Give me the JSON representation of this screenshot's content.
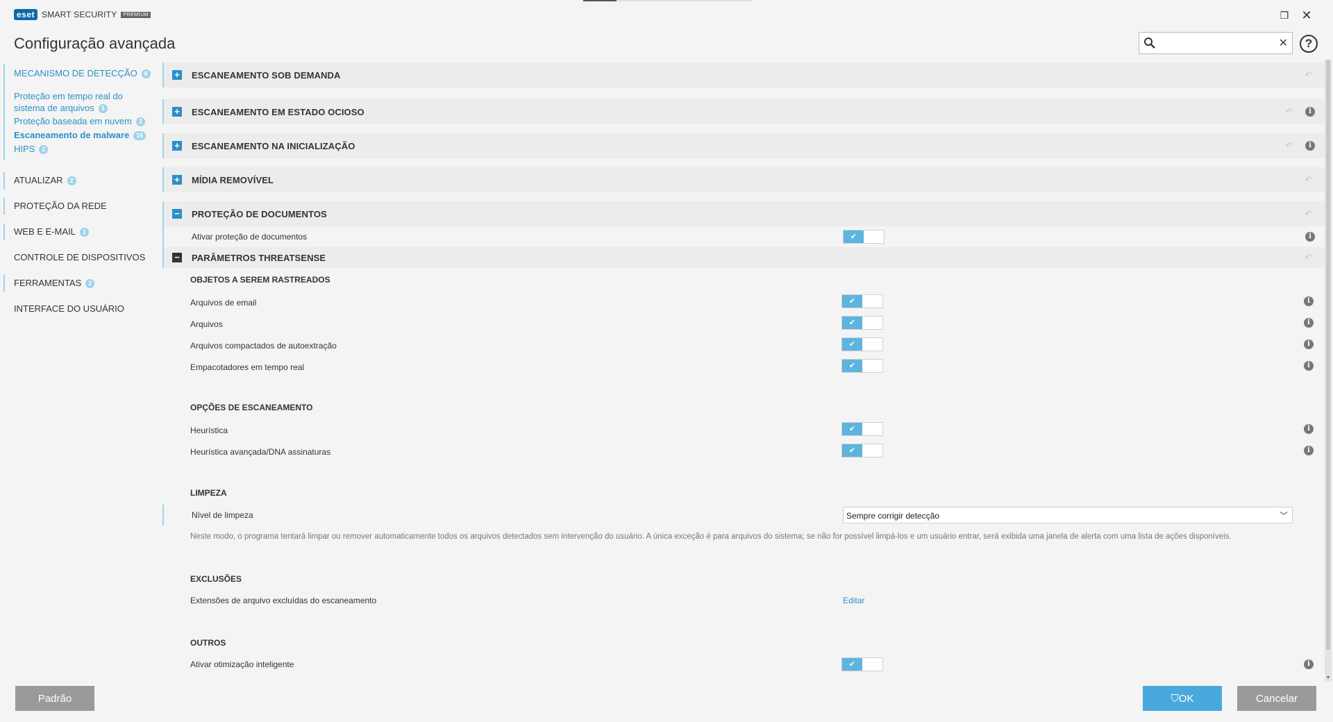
{
  "app": {
    "logo": "eset",
    "product": "SMART SECURITY",
    "edition": "PREMIUM",
    "title": "Configuração avançada"
  },
  "search": {
    "placeholder": "",
    "value": ""
  },
  "sidebar": {
    "detection": {
      "label": "MECANISMO DE DETECÇÃO",
      "badge": "6",
      "items": [
        {
          "label": "Proteção em tempo real do sistema de arquivos",
          "badge": "3"
        },
        {
          "label": "Proteção baseada em nuvem",
          "badge": "3"
        },
        {
          "label": "Escaneamento de malware",
          "badge": "16"
        },
        {
          "label": "HIPS",
          "badge": "2"
        }
      ]
    },
    "items": [
      {
        "label": "ATUALIZAR",
        "badge": "2"
      },
      {
        "label": "PROTEÇÃO DA REDE",
        "badge": ""
      },
      {
        "label": "WEB E E-MAIL",
        "badge": "1"
      },
      {
        "label": "CONTROLE DE DISPOSITIVOS",
        "badge": ""
      },
      {
        "label": "FERRAMENTAS",
        "badge": "2"
      },
      {
        "label": "INTERFACE DO USUÁRIO",
        "badge": ""
      }
    ]
  },
  "sections": {
    "on_demand": "ESCANEAMENTO SOB DEMANDA",
    "idle": "ESCANEAMENTO EM ESTADO OCIOSO",
    "startup": "ESCANEAMENTO NA INICIALIZAÇÃO",
    "removable": "MÍDIA REMOVÍVEL",
    "documents": "PROTEÇÃO DE DOCUMENTOS",
    "threatsense": "PARÂMETROS THREATSENSE"
  },
  "settings": {
    "enable_doc_protection": "Ativar proteção de documentos",
    "objects_title": "OBJETOS A SEREM RASTREADOS",
    "email_files": "Arquivos de email",
    "archives": "Arquivos",
    "sfx": "Arquivos compactados de autoextração",
    "runtime_packers": "Empacotadores em tempo real",
    "scan_options_title": "OPÇÕES DE ESCANEAMENTO",
    "heuristics": "Heurística",
    "adv_heuristics": "Heurística avançada/DNA assinaturas",
    "cleaning_title": "LIMPEZA",
    "cleaning_level": "Nível de limpeza",
    "cleaning_value": "Sempre corrigir detecção",
    "cleaning_desc": "Neste modo, o programa tentará limpar ou remover automaticamente todos os arquivos detectados sem intervenção do usuário. A única exceção é para arquivos do sistema; se não for possível limpá-los e um usuário entrar, será exibida uma janela de alerta com uma lista de ações disponíveis.",
    "exclusions_title": "EXCLUSÕES",
    "excluded_ext": "Extensões de arquivo excluídas do escaneamento",
    "edit_link": "Editar",
    "others_title": "OUTROS",
    "smart_opt": "Ativar otimização inteligente"
  },
  "footer": {
    "default": "Padrão",
    "ok": "OK",
    "cancel": "Cancelar"
  },
  "colors": {
    "accent": "#2b8fc7",
    "toggle_on": "#5db4df",
    "badge": "#9fd2ea",
    "button_gray": "#9a9a9a",
    "button_ok": "#4aa9dc"
  }
}
